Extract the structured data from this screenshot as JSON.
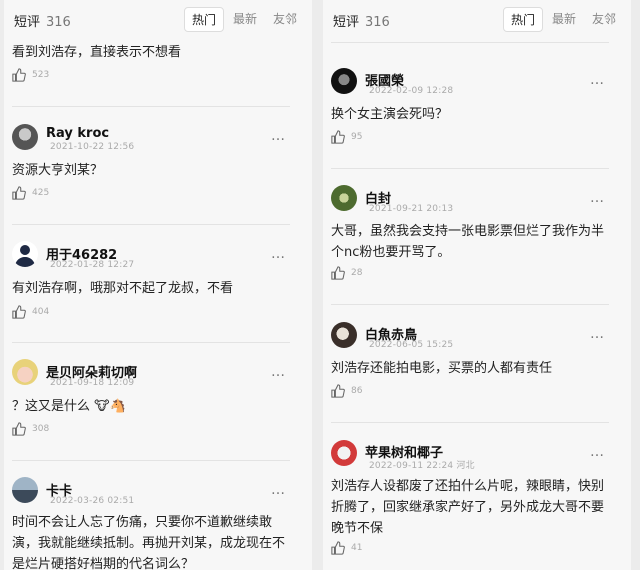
{
  "left": {
    "header": {
      "title": "短评",
      "count": "316",
      "tabs": [
        "热门",
        "最新",
        "友邻"
      ]
    },
    "comments": [
      {
        "text": "看到刘浩存，直接表示不想看",
        "likes": "523"
      },
      {
        "name": "Ray kroc",
        "date": "2021-10-22 12:56",
        "text": "资源大亨刘某？",
        "likes": "425"
      },
      {
        "name": "用于46282",
        "date": "2022-01-28 12:27",
        "text": "有刘浩存啊，哦那对不起了龙叔，不看",
        "likes": "404"
      },
      {
        "name": "是贝阿朵莉切啊",
        "date": "2021-09-18 12:09",
        "text": "？这又是什么 🐮🐴",
        "likes": "308"
      },
      {
        "name": "卡卡",
        "date": "2022-03-26 02:51",
        "text_lines": [
          "时间不会让人忘了伤痛，只要你不道歉继续敢",
          "演，我就能继续抵制。再抛开刘某，成龙现在不",
          "是烂片硬搭好档期的代名词么？"
        ]
      }
    ]
  },
  "right": {
    "header": {
      "title": "短评",
      "count": "316",
      "tabs": [
        "热门",
        "最新",
        "友邻"
      ]
    },
    "comments": [
      {
        "name": "張國榮",
        "date": "2022-02-09 12:28",
        "text": "换个女主演会死吗？",
        "likes": "95"
      },
      {
        "name": "白封",
        "date": "2021-09-21 20:13",
        "text_lines": [
          "大哥，虽然我会支持一张电影票但烂了我作为半",
          "个nc粉也要开骂了。"
        ],
        "likes": "28"
      },
      {
        "name": "白魚赤鳥",
        "date": "2022-06-05 15:25",
        "text": "刘浩存还能拍电影，买票的人都有责任",
        "likes": "86"
      },
      {
        "name": "苹果树和椰子",
        "date": "2022-09-11 22:24 河北",
        "text_lines": [
          "刘浩存人设都废了还拍什么片呢，辣眼睛，快别",
          "折腾了，回家继承家产好了，另外成龙大哥不要",
          "晚节不保"
        ],
        "likes": "41"
      }
    ]
  },
  "more_icon": "…",
  "icons": {
    "like": "thumbs-up-icon",
    "more": "more-options-icon"
  }
}
